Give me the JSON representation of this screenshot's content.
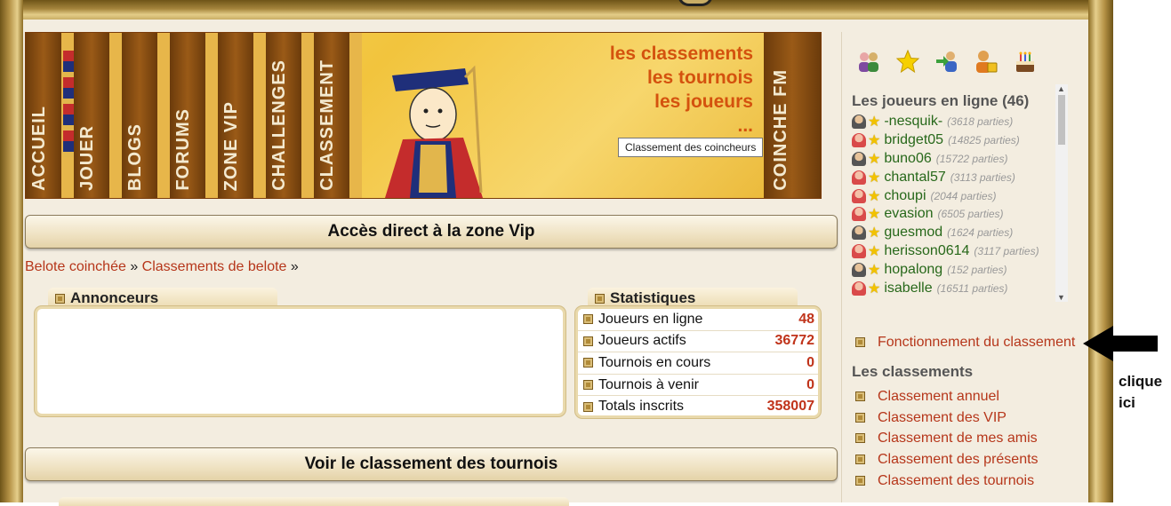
{
  "banner": {
    "tabs": [
      "ACCUEIL",
      "JOUER",
      "BLOGS",
      "FORUMS",
      "ZONE VIP",
      "CHALLENGES",
      "CLASSEMENT"
    ],
    "coinche_tab": "COINCHE FM",
    "lines": [
      "les classements",
      "les tournois",
      "les joueurs",
      "..."
    ],
    "tooltip": "Classement des coincheurs"
  },
  "vip_bar": {
    "label": "Accès direct à la zone Vip"
  },
  "breadcrumb": {
    "items": [
      "Belote coinchée",
      "Classements de belote"
    ],
    "separator": "»"
  },
  "annonceurs": {
    "title": "Annonceurs"
  },
  "statistiques": {
    "title": "Statistiques",
    "rows": [
      {
        "label": "Joueurs en ligne",
        "value": "48"
      },
      {
        "label": "Joueurs actifs",
        "value": "36772"
      },
      {
        "label": "Tournois en cours",
        "value": "0"
      },
      {
        "label": "Tournois à venir",
        "value": "0"
      },
      {
        "label": "Totals inscrits",
        "value": "358007"
      }
    ]
  },
  "tournament_bar": {
    "label": "Voir le classement des tournois"
  },
  "sidebar": {
    "icons": [
      "group-icon",
      "star-icon",
      "friends-icon",
      "user-lock-icon",
      "cake-icon"
    ],
    "online_title": "Les joueurs en ligne (46)",
    "players": [
      {
        "name": "-nesquik-",
        "count": "(3618 parties)",
        "gender": "m"
      },
      {
        "name": "bridget05",
        "count": "(14825 parties)",
        "gender": "f"
      },
      {
        "name": "buno06",
        "count": "(15722 parties)",
        "gender": "m"
      },
      {
        "name": "chantal57",
        "count": "(3113 parties)",
        "gender": "f"
      },
      {
        "name": "choupi",
        "count": "(2044 parties)",
        "gender": "f"
      },
      {
        "name": "evasion",
        "count": "(6505 parties)",
        "gender": "f"
      },
      {
        "name": "guesmod",
        "count": "(1624 parties)",
        "gender": "m"
      },
      {
        "name": "herisson0614",
        "count": "(3117 parties)",
        "gender": "f"
      },
      {
        "name": "hopalong",
        "count": "(152 parties)",
        "gender": "m"
      },
      {
        "name": "isabelle",
        "count": "(16511 parties)",
        "gender": "f"
      }
    ],
    "fonctionnement_link": "Fonctionnement du classement",
    "classements_title": "Les classements",
    "classements_links": [
      "Classement annuel",
      "Classement des VIP",
      "Classement de mes amis",
      "Classement des présents",
      "Classement des tournois"
    ]
  },
  "annotation": {
    "line1": "clique",
    "line2": "ici"
  },
  "colors": {
    "link": "#b6361a",
    "player_name": "#27681a",
    "stat_value": "#c0331a"
  }
}
